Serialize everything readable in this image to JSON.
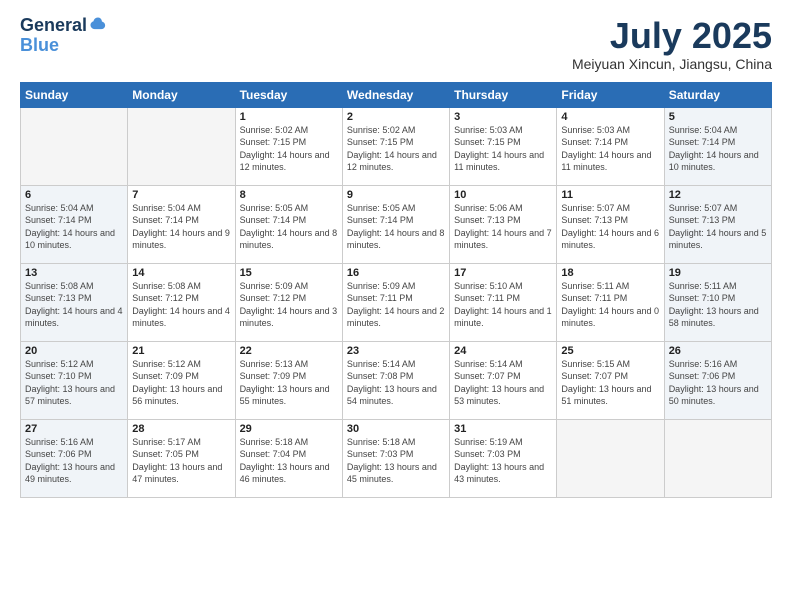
{
  "logo": {
    "line1": "General",
    "line2": "Blue"
  },
  "title": "July 2025",
  "location": "Meiyuan Xincun, Jiangsu, China",
  "weekdays": [
    "Sunday",
    "Monday",
    "Tuesday",
    "Wednesday",
    "Thursday",
    "Friday",
    "Saturday"
  ],
  "weeks": [
    [
      {
        "day": "",
        "empty": true
      },
      {
        "day": "",
        "empty": true
      },
      {
        "day": "1",
        "sunrise": "5:02 AM",
        "sunset": "7:15 PM",
        "daylight": "14 hours and 12 minutes."
      },
      {
        "day": "2",
        "sunrise": "5:02 AM",
        "sunset": "7:15 PM",
        "daylight": "14 hours and 12 minutes."
      },
      {
        "day": "3",
        "sunrise": "5:03 AM",
        "sunset": "7:15 PM",
        "daylight": "14 hours and 11 minutes."
      },
      {
        "day": "4",
        "sunrise": "5:03 AM",
        "sunset": "7:14 PM",
        "daylight": "14 hours and 11 minutes."
      },
      {
        "day": "5",
        "sunrise": "5:04 AM",
        "sunset": "7:14 PM",
        "daylight": "14 hours and 10 minutes."
      }
    ],
    [
      {
        "day": "6",
        "sunrise": "5:04 AM",
        "sunset": "7:14 PM",
        "daylight": "14 hours and 10 minutes."
      },
      {
        "day": "7",
        "sunrise": "5:04 AM",
        "sunset": "7:14 PM",
        "daylight": "14 hours and 9 minutes."
      },
      {
        "day": "8",
        "sunrise": "5:05 AM",
        "sunset": "7:14 PM",
        "daylight": "14 hours and 8 minutes."
      },
      {
        "day": "9",
        "sunrise": "5:05 AM",
        "sunset": "7:14 PM",
        "daylight": "14 hours and 8 minutes."
      },
      {
        "day": "10",
        "sunrise": "5:06 AM",
        "sunset": "7:13 PM",
        "daylight": "14 hours and 7 minutes."
      },
      {
        "day": "11",
        "sunrise": "5:07 AM",
        "sunset": "7:13 PM",
        "daylight": "14 hours and 6 minutes."
      },
      {
        "day": "12",
        "sunrise": "5:07 AM",
        "sunset": "7:13 PM",
        "daylight": "14 hours and 5 minutes."
      }
    ],
    [
      {
        "day": "13",
        "sunrise": "5:08 AM",
        "sunset": "7:13 PM",
        "daylight": "14 hours and 4 minutes."
      },
      {
        "day": "14",
        "sunrise": "5:08 AM",
        "sunset": "7:12 PM",
        "daylight": "14 hours and 4 minutes."
      },
      {
        "day": "15",
        "sunrise": "5:09 AM",
        "sunset": "7:12 PM",
        "daylight": "14 hours and 3 minutes."
      },
      {
        "day": "16",
        "sunrise": "5:09 AM",
        "sunset": "7:11 PM",
        "daylight": "14 hours and 2 minutes."
      },
      {
        "day": "17",
        "sunrise": "5:10 AM",
        "sunset": "7:11 PM",
        "daylight": "14 hours and 1 minute."
      },
      {
        "day": "18",
        "sunrise": "5:11 AM",
        "sunset": "7:11 PM",
        "daylight": "14 hours and 0 minutes."
      },
      {
        "day": "19",
        "sunrise": "5:11 AM",
        "sunset": "7:10 PM",
        "daylight": "13 hours and 58 minutes."
      }
    ],
    [
      {
        "day": "20",
        "sunrise": "5:12 AM",
        "sunset": "7:10 PM",
        "daylight": "13 hours and 57 minutes."
      },
      {
        "day": "21",
        "sunrise": "5:12 AM",
        "sunset": "7:09 PM",
        "daylight": "13 hours and 56 minutes."
      },
      {
        "day": "22",
        "sunrise": "5:13 AM",
        "sunset": "7:09 PM",
        "daylight": "13 hours and 55 minutes."
      },
      {
        "day": "23",
        "sunrise": "5:14 AM",
        "sunset": "7:08 PM",
        "daylight": "13 hours and 54 minutes."
      },
      {
        "day": "24",
        "sunrise": "5:14 AM",
        "sunset": "7:07 PM",
        "daylight": "13 hours and 53 minutes."
      },
      {
        "day": "25",
        "sunrise": "5:15 AM",
        "sunset": "7:07 PM",
        "daylight": "13 hours and 51 minutes."
      },
      {
        "day": "26",
        "sunrise": "5:16 AM",
        "sunset": "7:06 PM",
        "daylight": "13 hours and 50 minutes."
      }
    ],
    [
      {
        "day": "27",
        "sunrise": "5:16 AM",
        "sunset": "7:06 PM",
        "daylight": "13 hours and 49 minutes."
      },
      {
        "day": "28",
        "sunrise": "5:17 AM",
        "sunset": "7:05 PM",
        "daylight": "13 hours and 47 minutes."
      },
      {
        "day": "29",
        "sunrise": "5:18 AM",
        "sunset": "7:04 PM",
        "daylight": "13 hours and 46 minutes."
      },
      {
        "day": "30",
        "sunrise": "5:18 AM",
        "sunset": "7:03 PM",
        "daylight": "13 hours and 45 minutes."
      },
      {
        "day": "31",
        "sunrise": "5:19 AM",
        "sunset": "7:03 PM",
        "daylight": "13 hours and 43 minutes."
      },
      {
        "day": "",
        "empty": true
      },
      {
        "day": "",
        "empty": true
      }
    ]
  ]
}
